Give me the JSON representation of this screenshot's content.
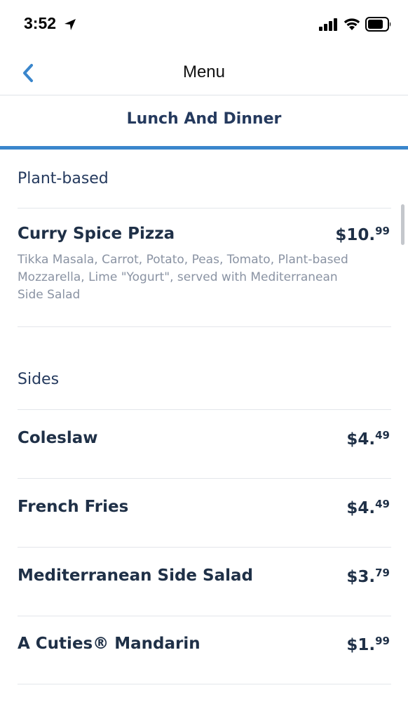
{
  "status_bar": {
    "time": "3:52",
    "icons": [
      "location-arrow-icon",
      "cellular-signal-icon",
      "wifi-icon",
      "battery-icon"
    ]
  },
  "nav": {
    "title": "Menu",
    "back_icon": "chevron-left-icon"
  },
  "tabs": [
    {
      "label": "Lunch And Dinner",
      "selected": true
    }
  ],
  "colors": {
    "accent": "#3a86cc",
    "text_dark": "#1f3047",
    "text_muted": "#8a93a3",
    "divider": "#e3e6ea"
  },
  "sections": [
    {
      "title": "Plant-based",
      "items": [
        {
          "name": "Curry Spice Pizza",
          "price_dollars": "$10.",
          "price_cents": "99",
          "description": "Tikka Masala, Carrot, Potato, Peas, Tomato, Plant-based Mozzarella, Lime \"Yogurt\", served with Mediterranean Side Salad"
        }
      ]
    },
    {
      "title": "Sides",
      "items": [
        {
          "name": "Coleslaw",
          "price_dollars": "$4.",
          "price_cents": "49"
        },
        {
          "name": "French Fries",
          "price_dollars": "$4.",
          "price_cents": "49"
        },
        {
          "name": "Mediterranean Side Salad",
          "price_dollars": "$3.",
          "price_cents": "79"
        },
        {
          "name": "A Cuties® Mandarin",
          "price_dollars": "$1.",
          "price_cents": "99"
        }
      ]
    }
  ]
}
